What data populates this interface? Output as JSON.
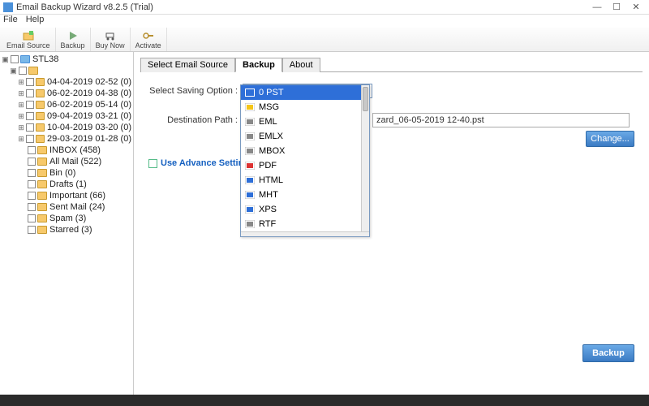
{
  "window": {
    "title": "Email Backup Wizard v8.2.5 (Trial)",
    "min": "—",
    "max": "☐",
    "close": "✕"
  },
  "menu": {
    "file": "File",
    "help": "Help"
  },
  "toolbar": {
    "emailSource": "Email Source",
    "backup": "Backup",
    "buyNow": "Buy Now",
    "activate": "Activate"
  },
  "tree": {
    "root": "STL38",
    "dates": [
      "04-04-2019 02-52 (0)",
      "06-02-2019 04-38 (0)",
      "06-02-2019 05-14 (0)",
      "09-04-2019 03-21 (0)",
      "10-04-2019 03-20 (0)",
      "29-03-2019 01-28 (0)"
    ],
    "folders": [
      "INBOX (458)",
      "All Mail (522)",
      "Bin (0)",
      "Drafts (1)",
      "Important (66)",
      "Sent Mail (24)",
      "Spam (3)",
      "Starred (3)"
    ]
  },
  "tabs": {
    "source": "Select Email Source",
    "backup": "Backup",
    "about": "About"
  },
  "form": {
    "savingLabel": "Select Saving Option :",
    "savingValue": "PST",
    "destLabel": "Destination Path :",
    "destValue": "zard_06-05-2019 12-40.pst",
    "changeBtn": "Change...",
    "advance": "Use Advance Settings"
  },
  "dropdown": {
    "options": [
      "PST",
      "MSG",
      "EML",
      "EMLX",
      "MBOX",
      "PDF",
      "HTML",
      "MHT",
      "XPS",
      "RTF"
    ],
    "selectedIndex": 0,
    "selectedPrefix": "0"
  },
  "iconColors": {
    "PST": "#2e6fd8",
    "MSG": "#f5c518",
    "EML": "#888",
    "EMLX": "#888",
    "MBOX": "#888",
    "PDF": "#d33",
    "HTML": "#2e6fd8",
    "MHT": "#2e6fd8",
    "XPS": "#2e6fd8",
    "RTF": "#888"
  },
  "backupBtn": "Backup"
}
